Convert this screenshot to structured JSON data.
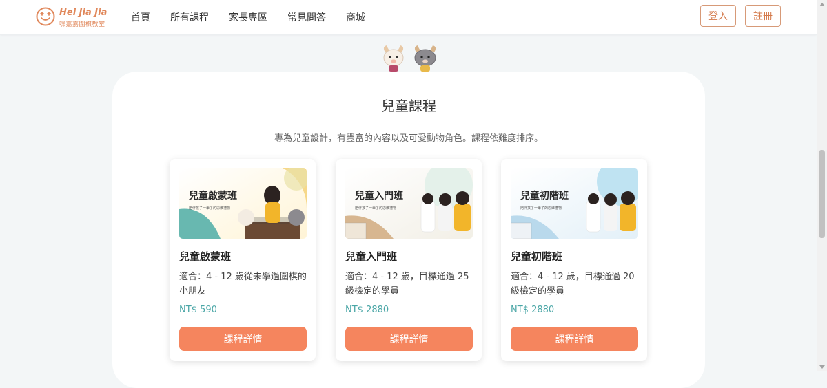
{
  "brand": {
    "name": "Hei Jia Jia",
    "subtitle": "嘿嘉嘉圍棋教室",
    "color": "#e0875a"
  },
  "nav": {
    "items": [
      "首頁",
      "所有課程",
      "家長專區",
      "常見問答",
      "商城"
    ]
  },
  "auth": {
    "login_label": "登入",
    "register_label": "註冊"
  },
  "section": {
    "title": "兒童課程",
    "description": "專為兒童設計，有豐富的內容以及可愛動物角色。課程依難度排序。"
  },
  "courses": [
    {
      "image_title": "兒童啟蒙班",
      "image_subtitle": "陪伴孩子一輩子的思維禮物",
      "name": "兒童啟蒙班",
      "description": "適合：4 - 12 歲從未學過圍棋的小朋友",
      "price": "NT$ 590",
      "button": "課程詳情"
    },
    {
      "image_title": "兒童入門班",
      "image_subtitle": "陪伴孩子一輩子的思維禮物",
      "name": "兒童入門班",
      "description": "適合：4 - 12 歲，目標通過 25 級檢定的學員",
      "price": "NT$ 2880",
      "button": "課程詳情"
    },
    {
      "image_title": "兒童初階班",
      "image_subtitle": "陪伴孩子一輩子的思維禮物",
      "name": "兒童初階班",
      "description": "適合：4 - 12 歲，目標通過 20 級檢定的學員",
      "price": "NT$ 2880",
      "button": "課程詳情"
    }
  ],
  "colors": {
    "accent": "#f5855e",
    "price": "#4aa6a6",
    "background": "#f3f6f7"
  }
}
